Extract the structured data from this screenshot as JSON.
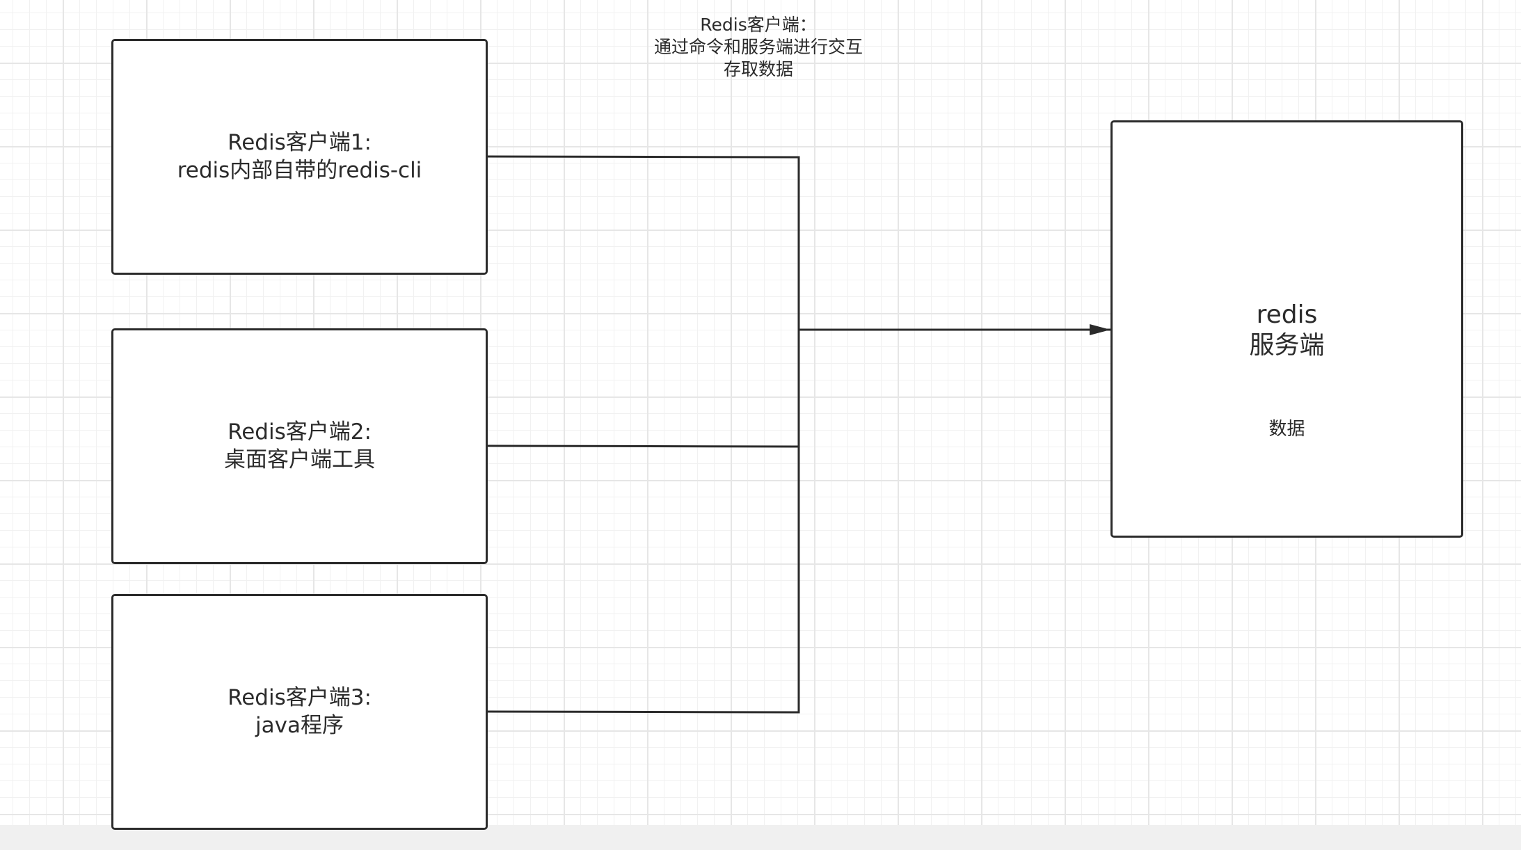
{
  "annotation": {
    "line1": "Redis客户端：",
    "line2": "通过命令和服务端进行交互",
    "line3": "存取数据"
  },
  "clients": [
    {
      "line1": "Redis客户端1:",
      "line2": "redis内部自带的redis-cli"
    },
    {
      "line1": "Redis客户端2:",
      "line2": "桌面客户端工具"
    },
    {
      "line1": "Redis客户端3:",
      "line2": "java程序"
    }
  ],
  "server": {
    "line1": "redis",
    "line2": "服务端",
    "data_label": "数据"
  },
  "colors": {
    "stroke": "#2b2b2b",
    "grid_major": "#e6e6e6",
    "grid_minor": "#f1f1f1",
    "background": "#ffffff"
  }
}
